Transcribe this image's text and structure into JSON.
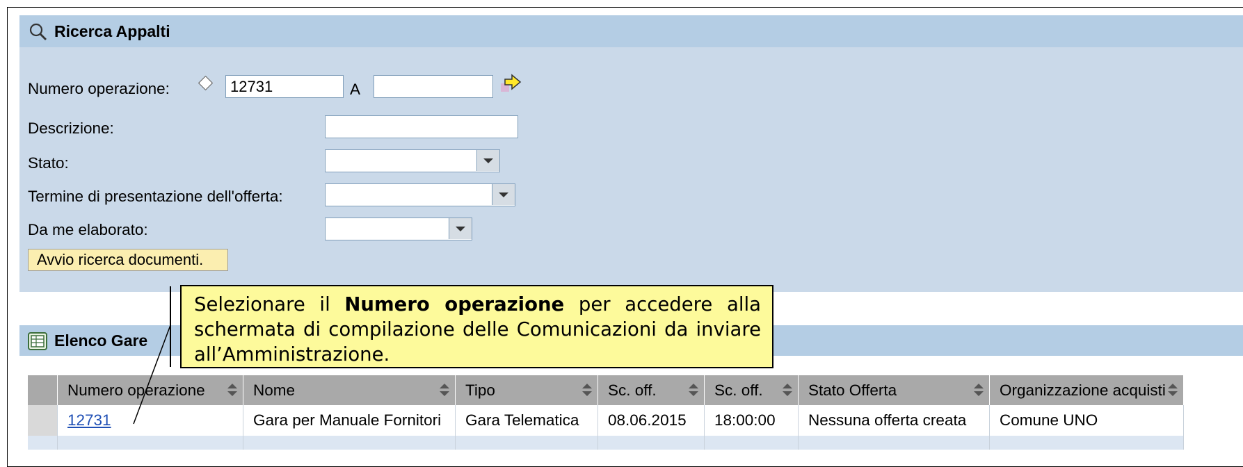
{
  "search_panel": {
    "title": "Ricerca Appalti",
    "numero_label": "Numero operazione:",
    "numero_from": "12731",
    "range_separator": "A",
    "numero_to": "",
    "descrizione_label": "Descrizione:",
    "stato_label": "Stato:",
    "termine_label": "Termine di presentazione dell'offerta:",
    "elaborato_label": "Da me elaborato:",
    "search_button": "Avvio ricerca documenti."
  },
  "list_panel": {
    "title": "Elenco Gare",
    "columns": [
      "Numero operazione",
      "Nome",
      "Tipo",
      "Sc. off.",
      "Sc. off.",
      "Stato Offerta",
      "Organizzazione acquisti"
    ],
    "rows": [
      [
        "12731",
        "Gara per Manuale Fornitori",
        "Gara Telematica",
        "08.06.2015",
        "18:00:00",
        "Nessuna offerta creata",
        "Comune UNO"
      ]
    ]
  },
  "callout": {
    "text_before": "Selezionare il",
    "text_bold": "Numero operazione",
    "text_after": "per accedere alla schermata di compilazione delle Comunicazioni da inviare all’Amministrazione."
  },
  "colors": {
    "panel_bg": "#cad9e9",
    "header_bg": "#b4cde4",
    "button_bg": "#fbeeb0",
    "callout_bg": "#fdfa9b",
    "link": "#1f4fb5"
  },
  "icons": [
    "search-icon",
    "arrow-right-icon",
    "table-icon",
    "dropdown-arrow-icon",
    "sort-icon"
  ]
}
